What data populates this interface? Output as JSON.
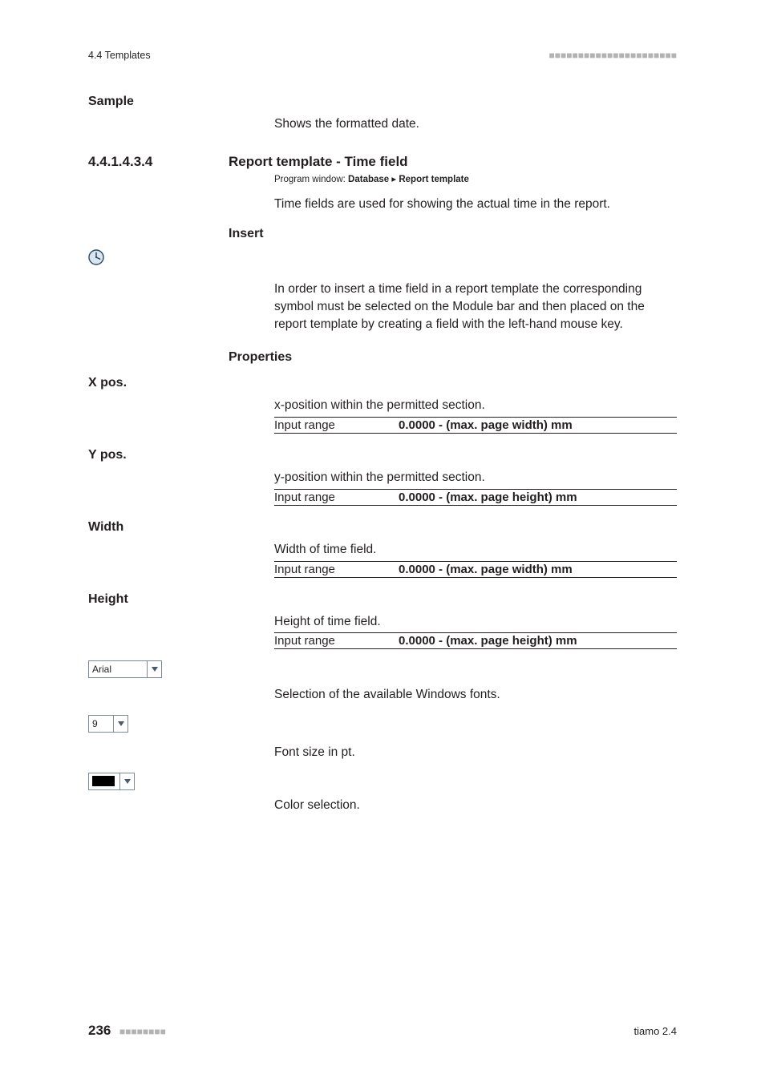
{
  "header": {
    "section": "4.4 Templates"
  },
  "sample": {
    "label": "Sample",
    "desc": "Shows the formatted date."
  },
  "section_4_4_1_4_3_4": {
    "number": "4.4.1.4.3.4",
    "title": "Report template - Time field",
    "breadcrumb_prefix": "Program window: ",
    "breadcrumb_bold1": "Database",
    "breadcrumb_sep": " ▸ ",
    "breadcrumb_bold2": "Report template",
    "intro": "Time fields are used for showing the actual time in the report.",
    "insert_label": "Insert",
    "insert_desc": "In order to insert a time field in a report template the corresponding symbol must be selected on the Module bar and then placed on the report template by creating a field with the left-hand mouse key.",
    "properties_label": "Properties"
  },
  "props": {
    "xpos": {
      "label": "X pos.",
      "desc": "x-position within the permitted section.",
      "range_label": "Input range",
      "range_value": "0.0000 - (max. page width) mm"
    },
    "ypos": {
      "label": "Y pos.",
      "desc": "y-position within the permitted section.",
      "range_label": "Input range",
      "range_value": "0.0000 - (max. page height) mm"
    },
    "width": {
      "label": "Width",
      "desc": "Width of time field.",
      "range_label": "Input range",
      "range_value": "0.0000 - (max. page width) mm"
    },
    "height": {
      "label": "Height",
      "desc": "Height of time field.",
      "range_label": "Input range",
      "range_value": "0.0000 - (max. page height) mm"
    },
    "font": {
      "value": "Arial",
      "desc": "Selection of the available Windows fonts."
    },
    "size": {
      "value": "9",
      "desc": "Font size in pt."
    },
    "color": {
      "desc": "Color selection."
    }
  },
  "footer": {
    "page": "236",
    "product": "tiamo 2.4"
  }
}
